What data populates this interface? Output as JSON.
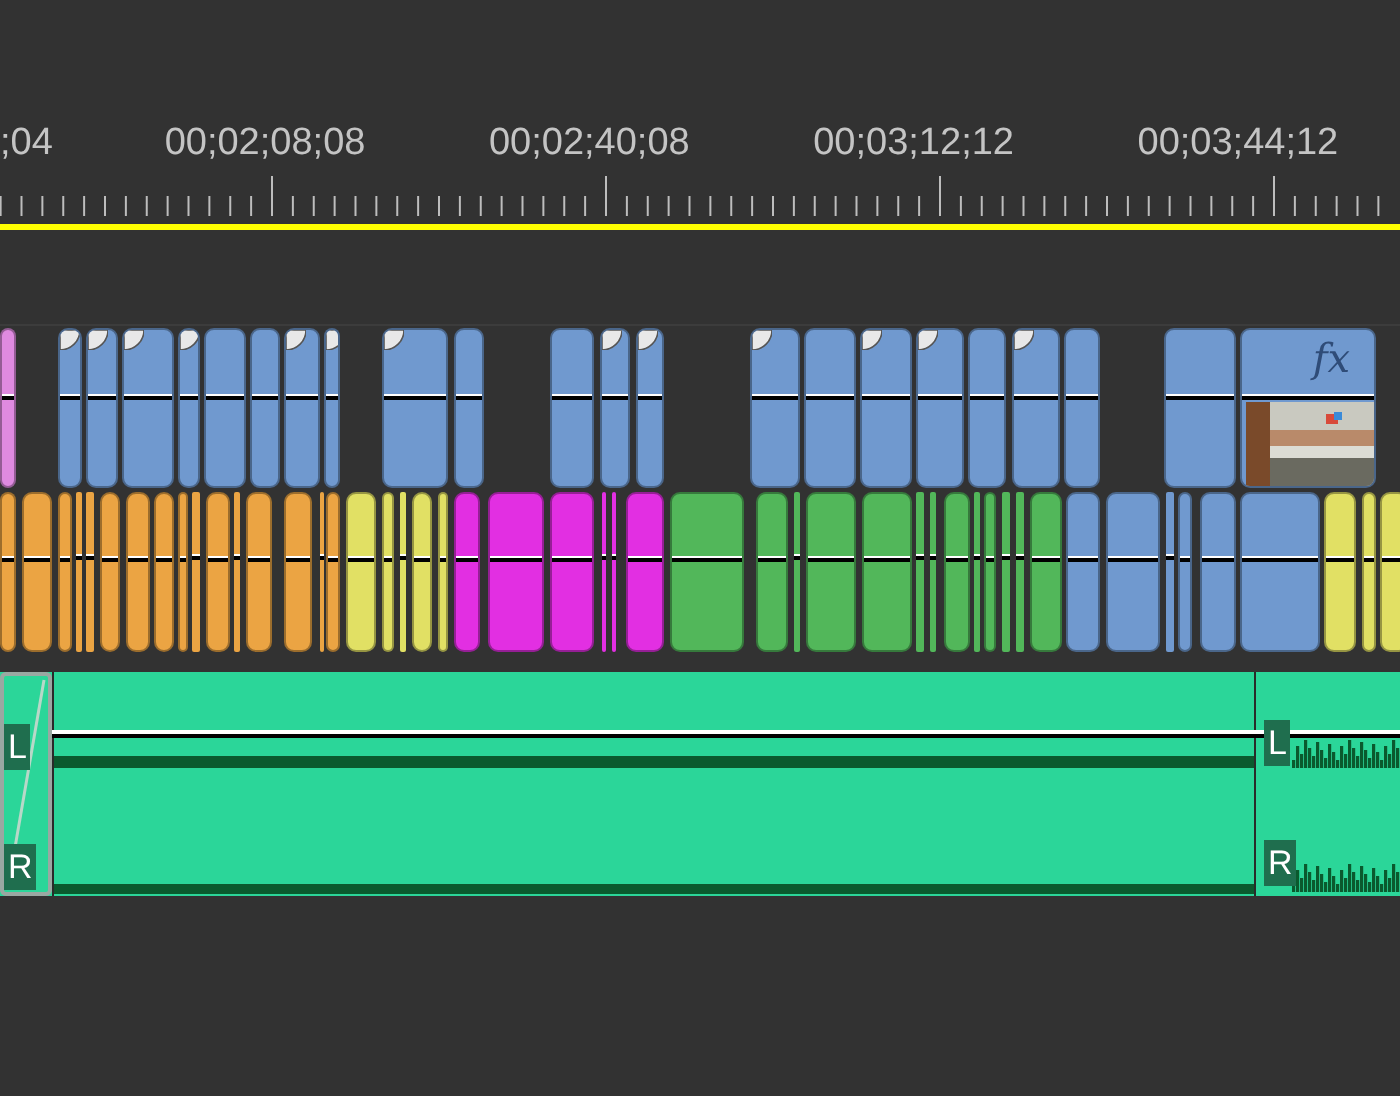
{
  "ruler": {
    "labels": [
      ";04",
      "00;02;08;08",
      "00;02;40;08",
      "00;03;12;12",
      "00;03;44;12"
    ]
  },
  "video_tracks": [
    {
      "clips": [
        {
          "color": "#df8ae0",
          "transition": false
        },
        {
          "color": "#7099cf",
          "transition": true
        },
        {
          "color": "#7099cf",
          "transition": true
        },
        {
          "color": "#7099cf",
          "transition": true
        },
        {
          "color": "#7099cf",
          "transition": true
        },
        {
          "color": "#7099cf",
          "transition": false
        },
        {
          "color": "#7099cf",
          "transition": false
        },
        {
          "color": "#7099cf",
          "transition": true
        },
        {
          "color": "#7099cf",
          "transition": true
        },
        {
          "color": "#7099cf",
          "transition": true
        },
        {
          "color": "#7099cf",
          "transition": false
        },
        {
          "color": "#7099cf",
          "transition": false
        },
        {
          "color": "#7099cf",
          "transition": true
        },
        {
          "color": "#7099cf",
          "transition": true
        },
        {
          "color": "#7099cf",
          "transition": true
        },
        {
          "color": "#7099cf",
          "transition": false
        },
        {
          "color": "#7099cf",
          "transition": true
        },
        {
          "color": "#7099cf",
          "transition": true
        },
        {
          "color": "#7099cf",
          "transition": false
        },
        {
          "color": "#7099cf",
          "transition": true
        },
        {
          "color": "#7099cf",
          "transition": false
        },
        {
          "color": "#7099cf",
          "transition": false
        },
        {
          "color": "#7099cf",
          "transition": false,
          "effect": "fx",
          "kind": "picture"
        }
      ]
    },
    {
      "clips": [
        {
          "color": "#eba443"
        },
        {
          "color": "#eba443"
        },
        {
          "color": "#eba443"
        },
        {
          "color": "#eba443"
        },
        {
          "color": "#eba443"
        },
        {
          "color": "#eba443"
        },
        {
          "color": "#eba443"
        },
        {
          "color": "#eba443"
        },
        {
          "color": "#eba443"
        },
        {
          "color": "#eba443"
        },
        {
          "color": "#eba443"
        },
        {
          "color": "#eba443"
        },
        {
          "color": "#eba443"
        },
        {
          "color": "#eba443"
        },
        {
          "color": "#eba443"
        },
        {
          "color": "#eba443"
        },
        {
          "color": "#e1e064"
        },
        {
          "color": "#e1e064"
        },
        {
          "color": "#e1e064"
        },
        {
          "color": "#e1e064"
        },
        {
          "color": "#e1e064"
        },
        {
          "color": "#e22fe2"
        },
        {
          "color": "#e22fe2"
        },
        {
          "color": "#e22fe2"
        },
        {
          "color": "#e22fe2"
        },
        {
          "color": "#e22fe2"
        },
        {
          "color": "#e22fe2"
        },
        {
          "color": "#52b75a"
        },
        {
          "color": "#52b75a"
        },
        {
          "color": "#52b75a"
        },
        {
          "color": "#52b75a"
        },
        {
          "color": "#52b75a"
        },
        {
          "color": "#52b75a"
        },
        {
          "color": "#52b75a"
        },
        {
          "color": "#52b75a"
        },
        {
          "color": "#52b75a"
        },
        {
          "color": "#52b75a"
        },
        {
          "color": "#52b75a"
        },
        {
          "color": "#52b75a"
        },
        {
          "color": "#52b75a"
        },
        {
          "color": "#7099cf"
        },
        {
          "color": "#7099cf"
        },
        {
          "color": "#7099cf"
        },
        {
          "color": "#7099cf"
        },
        {
          "color": "#7099cf"
        },
        {
          "color": "#7099cf"
        },
        {
          "color": "#e1e064"
        },
        {
          "color": "#e1e064"
        },
        {
          "color": "#e1e064"
        }
      ]
    }
  ],
  "audio_track": {
    "clips": [
      {
        "channels": [
          "L",
          "R"
        ],
        "selected": true
      },
      {
        "selected": false
      },
      {
        "channels": [
          "L",
          "R"
        ],
        "selected": false
      }
    ]
  }
}
